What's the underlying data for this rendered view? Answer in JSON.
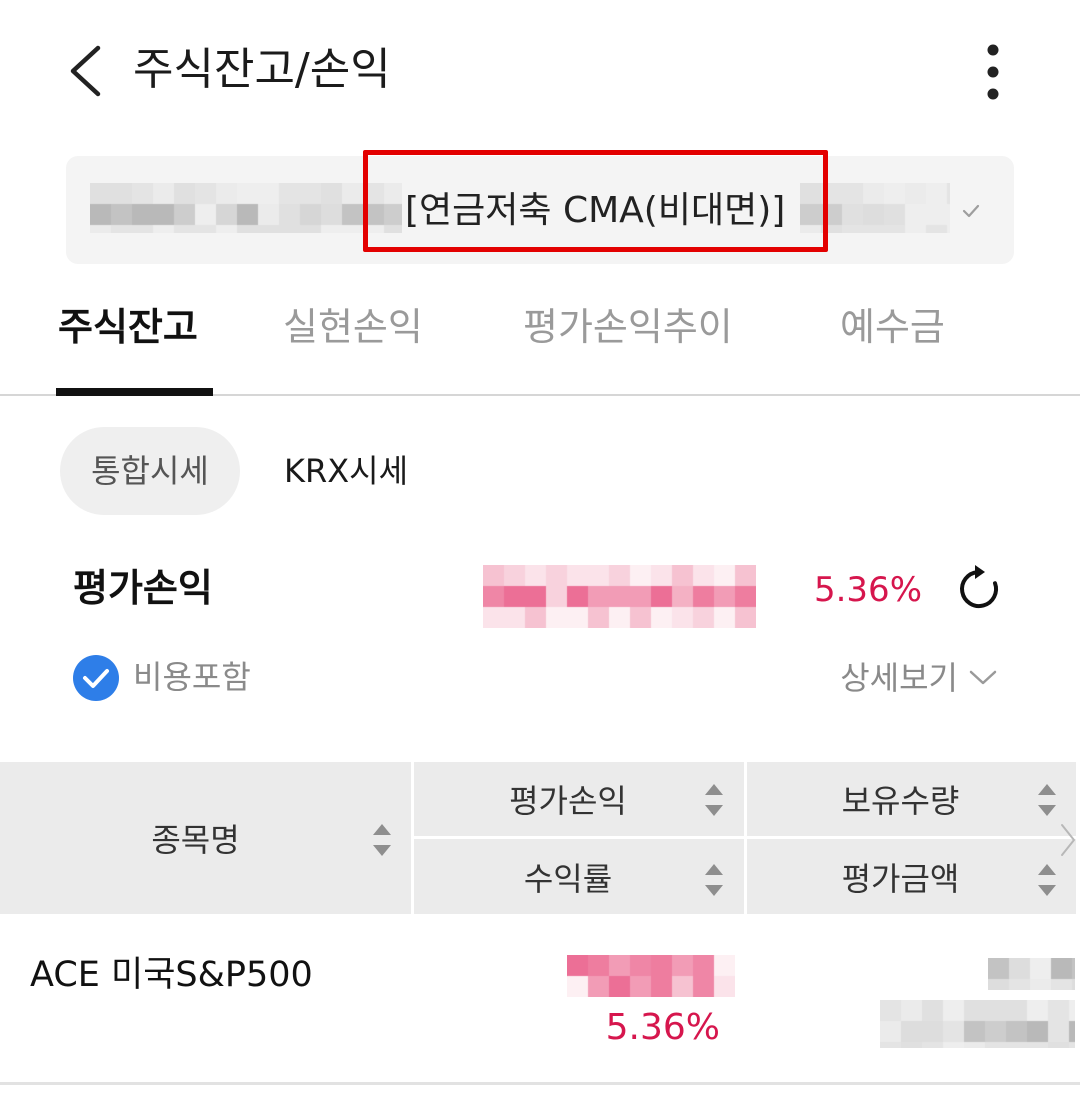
{
  "header": {
    "title": "주식잔고/손익",
    "back_icon": "chevron-left-icon",
    "menu_icon": "more-vertical-icon"
  },
  "account": {
    "label": "[연금저축 CMA(비대면)]",
    "dropdown_icon": "chevron-down-icon"
  },
  "tabs": [
    {
      "label": "주식잔고",
      "active": true
    },
    {
      "label": "실현손익",
      "active": false
    },
    {
      "label": "평가손익추이",
      "active": false
    },
    {
      "label": "예수금",
      "active": false
    }
  ],
  "price_toggle": [
    {
      "label": "통합시세",
      "selected": true
    },
    {
      "label": "KRX시세",
      "selected": false
    }
  ],
  "summary": {
    "label": "평가손익",
    "return_rate": "5.36%",
    "refresh_icon": "refresh-icon"
  },
  "options": {
    "include_fees": {
      "label": "비용포함",
      "checked": true,
      "icon": "check-circle-icon"
    },
    "details": {
      "label": "상세보기",
      "icon": "chevron-down-icon"
    }
  },
  "table": {
    "columns": {
      "name": "종목명",
      "profit": "평가손익",
      "quantity": "보유수량",
      "return_rate": "수익률",
      "eval_amount": "평가금액"
    },
    "sort_icon": "sort-icon",
    "scroll_icon": "chevron-right-icon",
    "rows": [
      {
        "name": "ACE 미국S&P500",
        "return_rate": "5.36%"
      }
    ]
  },
  "colors": {
    "gain": "#d6164d",
    "checkbox": "#2e7ee8",
    "highlight": "#e30000",
    "active_tab": "#111111",
    "inactive_tab": "#9a9a9a"
  }
}
